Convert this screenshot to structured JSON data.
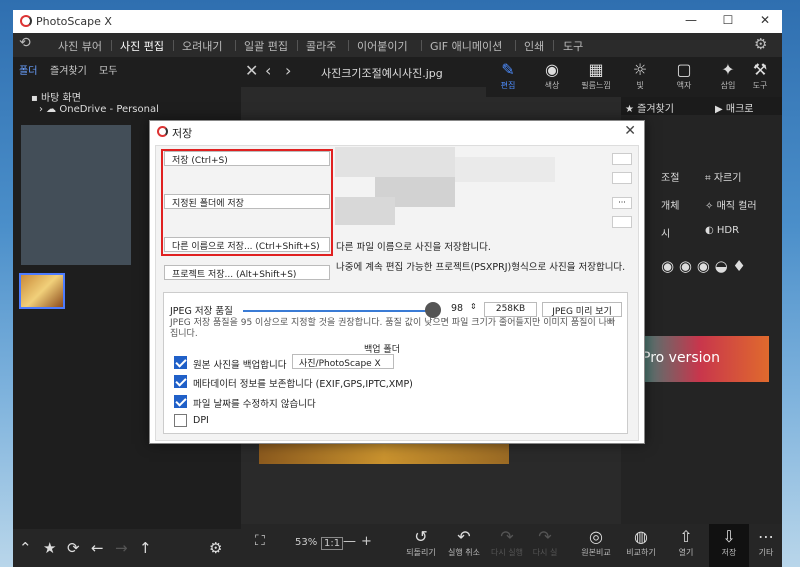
{
  "app": {
    "title": "PhotoScape X"
  },
  "menu": [
    "사진 뷰어",
    "사진 편집",
    "오려내기",
    "일괄 편집",
    "콜라주",
    "이어붙이기",
    "GIF 애니메이션",
    "인쇄",
    "도구"
  ],
  "menu_active_index": 1,
  "left_tabs": [
    "폴더",
    "즐겨찾기",
    "모두"
  ],
  "tree": {
    "desktop": "바탕 화면",
    "onedrive": "OneDrive - Personal"
  },
  "file_name": "사진크기조절예시사진.jpg",
  "toolbar": [
    {
      "label": "편집",
      "icon": "edit-icon",
      "glyph": "✎",
      "active": true
    },
    {
      "label": "색상",
      "icon": "color-icon",
      "glyph": "◉",
      "active": false
    },
    {
      "label": "필름느낌",
      "icon": "film-icon",
      "glyph": "▦",
      "active": false
    },
    {
      "label": "빛",
      "icon": "light-icon",
      "glyph": "☼",
      "active": false
    },
    {
      "label": "액자",
      "icon": "frame-icon",
      "glyph": "▢",
      "active": false
    },
    {
      "label": "삽입",
      "icon": "insert-icon",
      "glyph": "✦",
      "active": false
    },
    {
      "label": "도구",
      "icon": "tools-icon",
      "glyph": "⚒",
      "active": false
    }
  ],
  "right_panel": {
    "favorites": "즐겨찾기",
    "macro": "매크로",
    "adjust": "조절",
    "crop": "자르기",
    "object": "개체",
    "magic_color": "매직 컬러",
    "hdr": "HDR",
    "shi": "시"
  },
  "banner_text": "Pro version",
  "bottom": {
    "zoom": "53%",
    "zoom_fit": "1:1",
    "items": [
      {
        "label": "되돌리기",
        "icon": "revert-icon",
        "glyph": "↺",
        "dim": false
      },
      {
        "label": "실행 취소",
        "icon": "undo-icon",
        "glyph": "↶",
        "dim": false
      },
      {
        "label": "다시 실행",
        "icon": "redo-icon",
        "glyph": "↷",
        "dim": true
      },
      {
        "label": "다시 실",
        "icon": "redo-all-icon",
        "glyph": "↷",
        "dim": true
      },
      {
        "label": "원본비교",
        "icon": "compare-original-icon",
        "glyph": "◎",
        "dim": false
      },
      {
        "label": "비교하기",
        "icon": "compare-icon",
        "glyph": "◍",
        "dim": false
      },
      {
        "label": "열기",
        "icon": "open-icon",
        "glyph": "⇧",
        "dim": false
      },
      {
        "label": "저장",
        "icon": "save-icon",
        "glyph": "⇩",
        "dim": false,
        "active": true
      },
      {
        "label": "기타",
        "icon": "more-icon",
        "glyph": "⋯",
        "dim": false
      }
    ]
  },
  "dialog": {
    "title": "저장",
    "save_button": "저장  (Ctrl+S)",
    "save_folder_button": "지정된 폴더에 저장",
    "save_as_button": "다른 이름으로 저장...  (Ctrl+Shift+S)",
    "save_as_desc": "다른 파일 이름으로 사진을 저장합니다.",
    "project_button": "프로젝트 저장...  (Alt+Shift+S)",
    "project_desc": "나중에 계속 편집 가능한 프로젝트(PSXPRJ)형식으로 사진을 저장합니다.",
    "jpeg_quality_label": "JPEG 저장 품질",
    "jpeg_quality_value": "98",
    "jpeg_size": "258KB",
    "jpeg_preview_button": "JPEG 미리 보기",
    "jpeg_hint": "JPEG 저장 품질을 95 이상으로 지정할 것을 권장합니다. 품질 값이 낮으면 파일 크기가 줄어들지만 이미지 품질이 나빠집니다.",
    "backup_folder_label": "백업 폴더",
    "backup_folder_value": "사진/PhotoScape X",
    "options": [
      {
        "label": "원본 사진을 백업합니다",
        "checked": true
      },
      {
        "label": "메타데이터 정보를 보존합니다 (EXIF,GPS,IPTC,XMP)",
        "checked": true
      },
      {
        "label": "파일 날짜를 수정하지 않습니다",
        "checked": true
      },
      {
        "label": "DPI",
        "checked": false
      }
    ]
  },
  "colors": {
    "accent": "#4d8dff",
    "highlight": "#e02020",
    "check": "#2060c8"
  }
}
